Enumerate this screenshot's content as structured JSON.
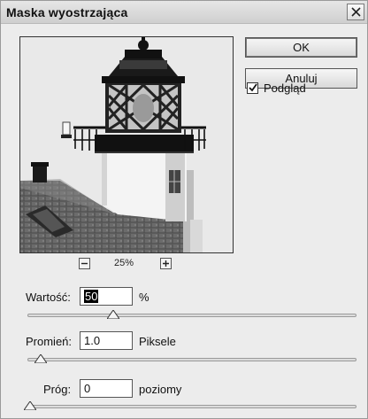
{
  "dialog": {
    "title": "Maska wyostrzająca",
    "close_icon": "close-icon"
  },
  "buttons": {
    "ok_label": "OK",
    "cancel_label": "Anuluj"
  },
  "preview_toggle": {
    "label": "Podgląd",
    "checked": true
  },
  "zoom": {
    "level": "25%",
    "zoom_out_icon": "minus-icon",
    "zoom_in_icon": "plus-icon"
  },
  "amount": {
    "label": "Wartość:",
    "value": "50",
    "unit": "%",
    "slider_fraction": 0.26
  },
  "radius": {
    "label": "Promień:",
    "value": "1.0",
    "unit": "Piksele",
    "slider_fraction": 0.04
  },
  "threshold": {
    "label": "Próg:",
    "value": "0",
    "unit": "poziomy",
    "slider_fraction": 0.0
  },
  "colors": {
    "dialog_bg": "#ececec",
    "selection": "#000000"
  }
}
